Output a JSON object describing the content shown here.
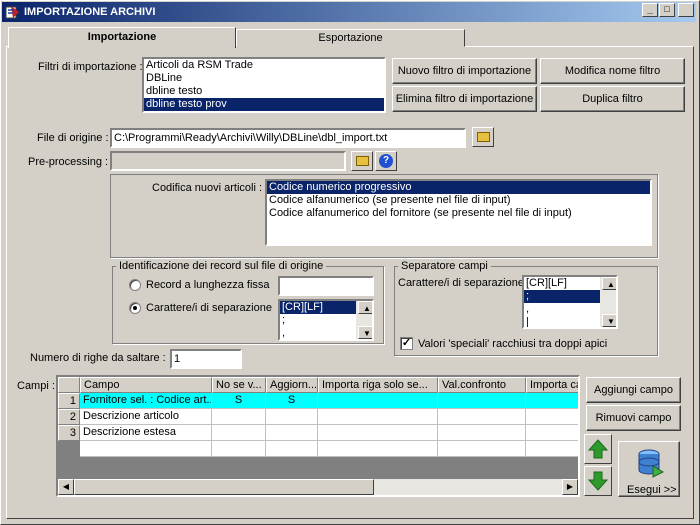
{
  "window": {
    "title": "IMPORTAZIONE ARCHIVI",
    "min": "_",
    "max": "□",
    "close": "×"
  },
  "tabs": [
    {
      "label": "Importazione"
    },
    {
      "label": "Esportazione"
    }
  ],
  "filters": {
    "label": "Filtri di importazione :",
    "items": [
      "Articoli da RSM Trade",
      "DBLine",
      "dbline testo",
      "dbline testo prov"
    ],
    "selected_index": 3,
    "new_btn": "Nuovo filtro di importazione",
    "rename_btn": "Modifica nome filtro",
    "delete_btn": "Elimina filtro di importazione",
    "dup_btn": "Duplica filtro"
  },
  "origin": {
    "label": "File di origine :",
    "value": "C:\\Programmi\\Ready\\Archivi\\Willy\\DBLine\\dbl_import.txt"
  },
  "preproc": {
    "label": "Pre-processing :",
    "value": "",
    "help": "?"
  },
  "codifica": {
    "label": "Codifica nuovi articoli :",
    "items": [
      "Codice numerico progressivo",
      "Codice alfanumerico (se presente nel file di input)",
      "Codice alfanumerico del fornitore (se presente nel file di input)"
    ],
    "selected_index": 0
  },
  "ident": {
    "title": "Identificazione dei record sul file di origine",
    "opt1": "Record a lunghezza fissa",
    "opt2": "Carattere/i di separazione",
    "selected": 2,
    "list": [
      "[CR][LF]",
      ";",
      ","
    ]
  },
  "sep": {
    "title": "Separatore campi",
    "label": "Carattere/i di separazione",
    "list": [
      "[CR][LF]",
      ";",
      ",",
      "|"
    ],
    "chk_label": "Valori 'speciali' racchiusi tra doppi apici",
    "checked": true
  },
  "skip": {
    "label": "Numero di righe da saltare :",
    "value": "1"
  },
  "fields": {
    "label": "Campi :",
    "columns": [
      "Campo",
      "No se v...",
      "Aggiorn...",
      "Importa riga solo se...",
      "Val.confronto",
      "Importa ca"
    ],
    "rows": [
      {
        "n": "1",
        "campo": "Fornitore sel. : Codice art...",
        "nosev": "S",
        "agg": "S",
        "imp": "",
        "val": "",
        "ca": ""
      },
      {
        "n": "2",
        "campo": "Descrizione articolo",
        "nosev": "",
        "agg": "",
        "imp": "",
        "val": "",
        "ca": ""
      },
      {
        "n": "3",
        "campo": "Descrizione estesa",
        "nosev": "",
        "agg": "",
        "imp": "",
        "val": "",
        "ca": ""
      }
    ],
    "add_btn": "Aggiungi campo",
    "remove_btn": "Rimuovi campo",
    "run_btn": "Esegui >>"
  },
  "colors": {
    "accent": "#0a246a",
    "highlight": "#00ffff",
    "green": "#2e9a2e"
  }
}
